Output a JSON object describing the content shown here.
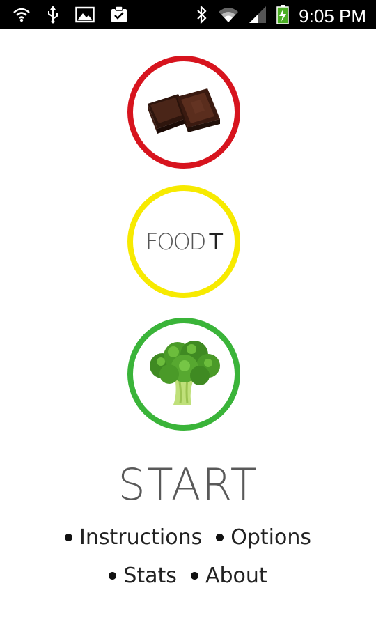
{
  "status_bar": {
    "time": "9:05 PM",
    "icons_left": [
      "wifi-alert-icon",
      "usb-icon",
      "image-icon",
      "clipboard-check-icon"
    ],
    "icons_right": [
      "bluetooth-icon",
      "wifi-icon",
      "signal-icon",
      "battery-charging-icon"
    ]
  },
  "circles": {
    "top": {
      "color": "#d7141e",
      "image": "chocolate-icon"
    },
    "middle": {
      "color": "#f7ea00",
      "logo_word": "FOOD",
      "logo_letter": "T"
    },
    "bottom": {
      "color": "#3ab439",
      "image": "broccoli-icon"
    }
  },
  "main": {
    "start_label": "START"
  },
  "menu": {
    "instructions": "Instructions",
    "options": "Options",
    "stats": "Stats",
    "about": "About"
  }
}
